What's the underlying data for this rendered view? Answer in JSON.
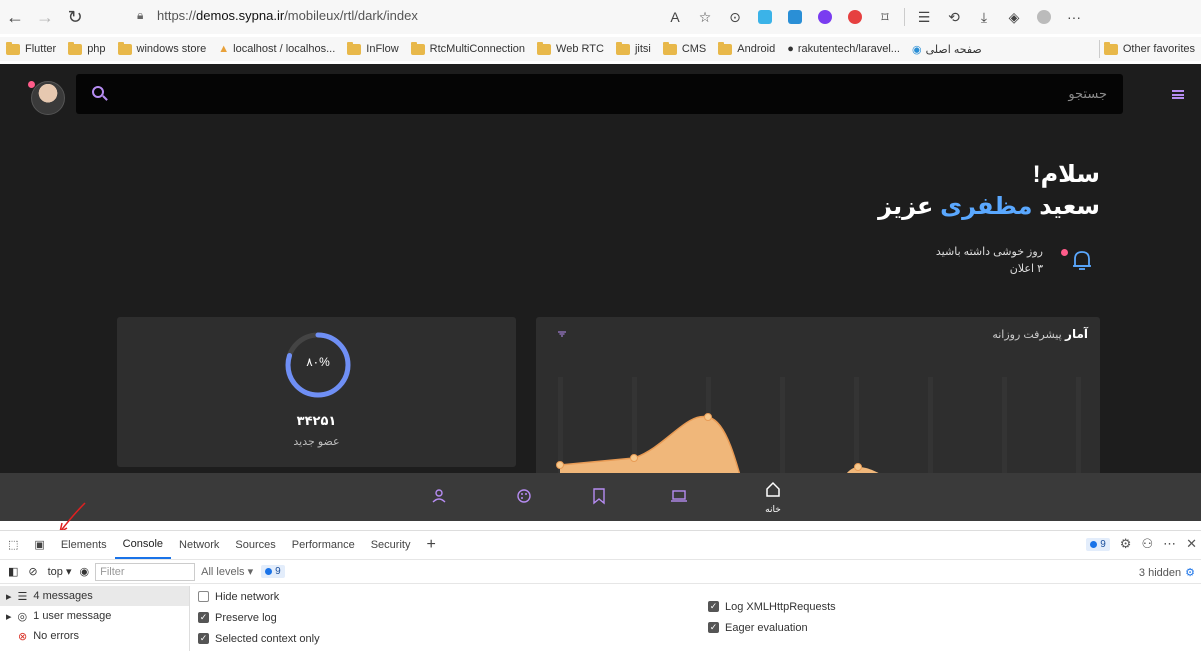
{
  "browser": {
    "url_prefix": "https://",
    "url_host": "demos.sypna.ir",
    "url_path": "/mobileux/rtl/dark/index",
    "toolbar_more": "···"
  },
  "bookmarks": {
    "items": [
      "Flutter",
      "php",
      "windows store",
      "localhost / localhos...",
      "InFlow",
      "RtcMultiConnection",
      "Web RTC",
      "jitsi",
      "CMS",
      "Android",
      "rakutentech/laravel...",
      "صفحه اصلی"
    ],
    "other": "Other favorites"
  },
  "app": {
    "search_placeholder": "جستجو",
    "greeting_line1": "سلام!",
    "greeting_first": "سعید",
    "greeting_highlight": "مظفری",
    "greeting_last": "عزیز",
    "notif_line1": "روز خوشی داشته باشید",
    "notif_line2": "۳ اعلان",
    "ring_label": "۸۰%",
    "ring_progress": 0.8,
    "members_count": "۳۴۲۵۱",
    "members_label": "عضو جدید",
    "chart_title": "آمار",
    "chart_subtitle": "پیشرفت روزانه",
    "home_label": "خانه"
  },
  "devtools": {
    "tabs": [
      "Elements",
      "Console",
      "Network",
      "Sources",
      "Performance",
      "Security"
    ],
    "active_tab": "Console",
    "badge_count": "9",
    "context": "top",
    "filter_placeholder": "Filter",
    "levels": "All levels",
    "hidden": "3 hidden",
    "sidebar": [
      "4 messages",
      "1 user message",
      "No errors"
    ],
    "options_left": [
      {
        "label": "Hide network",
        "checked": false
      },
      {
        "label": "Preserve log",
        "checked": true
      },
      {
        "label": "Selected context only",
        "checked": true
      }
    ],
    "options_right": [
      {
        "label": "Log XMLHttpRequests",
        "checked": true
      },
      {
        "label": "Eager evaluation",
        "checked": true
      }
    ]
  },
  "colors": {
    "accent": "#b68cf2",
    "highlight": "#5aa8ff",
    "ring": "#6f8ff5",
    "chart_fill": "#f0b77a",
    "notif_dot": "#ff5c8a"
  }
}
